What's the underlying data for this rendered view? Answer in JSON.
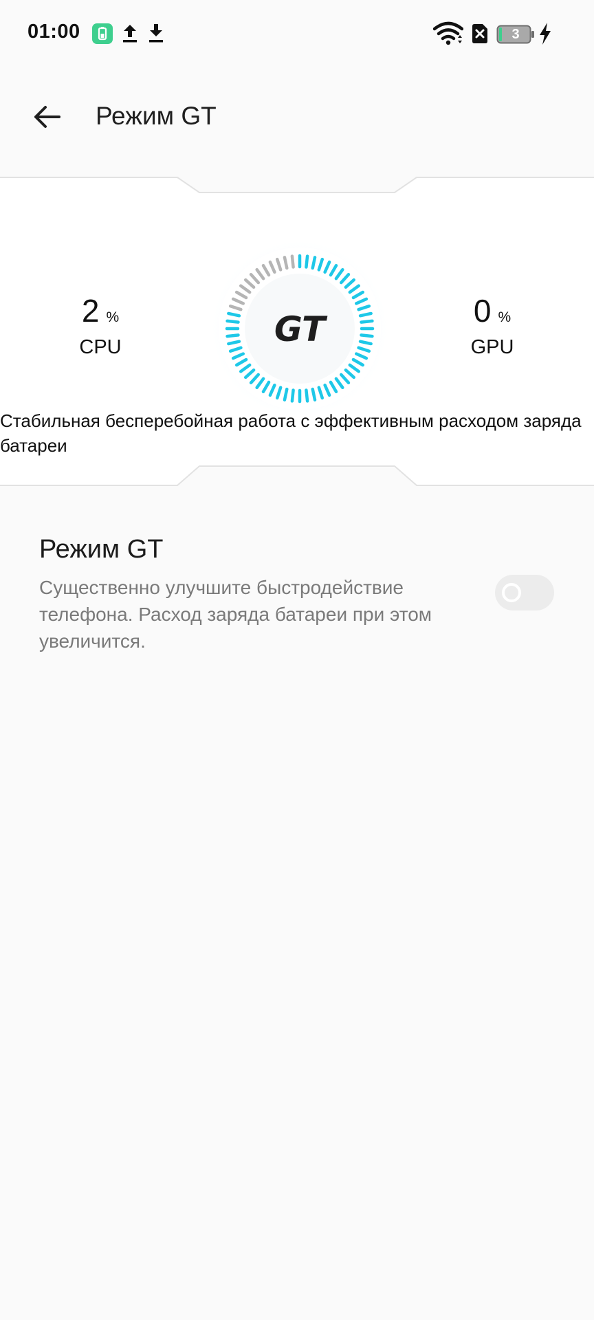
{
  "status_bar": {
    "time": "01:00",
    "battery_level": "3",
    "icons": [
      "battery-saver-icon",
      "upload-icon",
      "download-icon",
      "wifi-icon",
      "sim-missing-icon",
      "battery-icon",
      "charging-icon"
    ]
  },
  "app_bar": {
    "title": "Режим GT",
    "back_icon": "arrow-left-icon"
  },
  "panel": {
    "cpu": {
      "value": "2",
      "unit": "%",
      "label": "CPU"
    },
    "gpu": {
      "value": "0",
      "unit": "%",
      "label": "GPU"
    },
    "gauge_logo": "GT",
    "gauge_fill": 0.8,
    "description": "Стабильная бесперебойная работа с эффективным расходом заряда батареи"
  },
  "setting": {
    "title": "Режим GT",
    "summary": "Существенно улучшите быстродействие телефона. Расход заряда батареи при этом увеличится.",
    "enabled": false
  },
  "colors": {
    "background": "#fafafa",
    "accent": "#1ec8e8",
    "inactive_tick": "#b5b5b5",
    "toggle_off": "#ececec",
    "battery_saver": "#3ecf8e"
  }
}
